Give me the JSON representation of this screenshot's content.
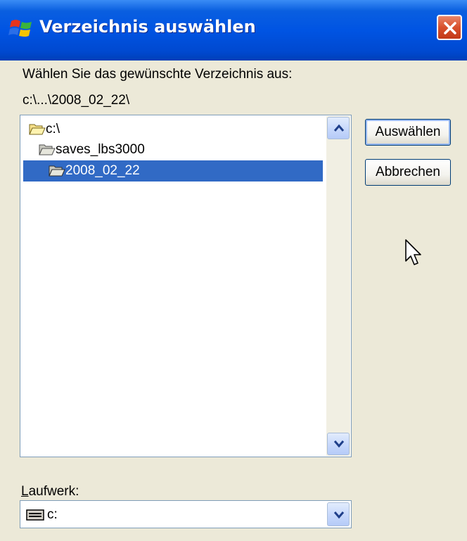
{
  "window": {
    "title": "Verzeichnis auswählen",
    "app_icon": "windows-flag-icon",
    "close_icon": "close-icon"
  },
  "prompt": "Wählen Sie das gewünschte Verzeichnis aus:",
  "current_path": "c:\\...\\2008_02_22\\",
  "tree": {
    "items": [
      {
        "label": "c:\\",
        "icon": "open-folder-icon",
        "level": 0,
        "selected": false
      },
      {
        "label": "saves_lbs3000",
        "icon": "open-folder-icon",
        "level": 1,
        "selected": false
      },
      {
        "label": "2008_02_22",
        "icon": "open-folder-icon",
        "level": 2,
        "selected": true
      }
    ]
  },
  "buttons": {
    "select": "Auswählen",
    "cancel": "Abbrechen"
  },
  "drive": {
    "label_accel": "L",
    "label_rest": "aufwerk:",
    "value": "c:",
    "icon": "drive-icon"
  },
  "colors": {
    "titlebar": "#0054e3",
    "selection": "#316ac5",
    "dialog_bg": "#ece9d8",
    "close_button": "#d8502c"
  }
}
